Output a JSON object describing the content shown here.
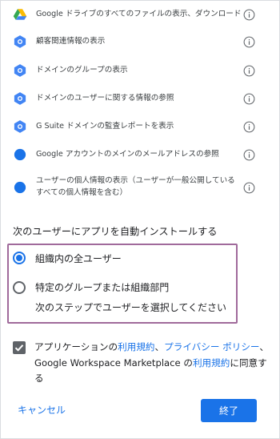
{
  "permissions": [
    {
      "text": "Google ドライブのすべてのファイルの表示、ダウンロード",
      "icon": "google-drive-icon"
    },
    {
      "text": "顧客関連情報の表示",
      "icon": "admin-hexagon-icon"
    },
    {
      "text": "ドメインのグループの表示",
      "icon": "admin-hexagon-icon"
    },
    {
      "text": "ドメインのユーザーに関する情報の参照",
      "icon": "admin-hexagon-icon"
    },
    {
      "text": "G Suite ドメインの監査レポートを表示",
      "icon": "admin-hexagon-icon"
    },
    {
      "text": "Google アカウントのメインのメールアドレスの参照",
      "icon": "blue-dot-icon"
    },
    {
      "text": "ユーザーの個人情報の表示（ユーザーが一般公開しているすべての個人情報を含む）",
      "icon": "blue-dot-icon"
    }
  ],
  "install_section": {
    "title": "次のユーザーにアプリを自動インストールする",
    "options": [
      {
        "label": "組織内の全ユーザー",
        "selected": true
      },
      {
        "label": "特定のグループまたは組織部門",
        "sublabel": "次のステップでユーザーを選択してください",
        "selected": false
      }
    ]
  },
  "agreement": {
    "checked": true,
    "prefix": "アプリケーションの",
    "terms_link": "利用規約",
    "sep1": "、",
    "privacy_link": "プライバシー ポリシー",
    "mid": "、Google Workspace Marketplace の",
    "terms_link2": "利用規約",
    "suffix": "に同意する"
  },
  "actions": {
    "cancel": "キャンセル",
    "finish": "終了"
  },
  "colors": {
    "accent": "#1a73e8",
    "admin_icon": "#4285f4",
    "highlight_border": "#a06a9b"
  }
}
